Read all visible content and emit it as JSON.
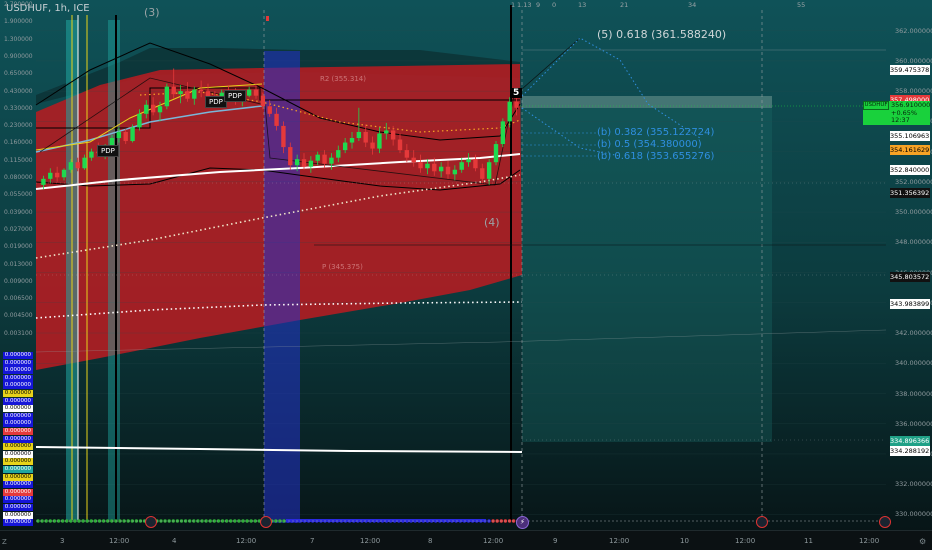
{
  "header": {
    "symbol_line": "USDHUF, 1h, ICE"
  },
  "colors": {
    "bull": "#26a69a",
    "bull_fill": "#1fd94f",
    "bear": "#e5393a",
    "cloud_red": "#b11d22",
    "teal": "#0e5155",
    "blue_zone": "#2232c8",
    "accent_green": "#19d13c",
    "white": "#ffffff",
    "fib_blue": "#2f8fe0"
  },
  "chart_data": {
    "type": "candlestick",
    "price_axis_right": {
      "ticks": [
        "362.000000",
        "360.000000",
        "358.000000",
        "356.000000",
        "354.000000",
        "352.000000",
        "350.000000",
        "348.000000",
        "346.000000",
        "344.000000",
        "342.000000",
        "340.000000",
        "338.000000",
        "336.000000",
        "334.000000",
        "332.000000",
        "330.000000"
      ],
      "range": [
        329.5,
        363.5
      ]
    },
    "price_tags": [
      {
        "label": "359.475378",
        "value": 359.475,
        "bg": "#ffffff",
        "fg": "#000000"
      },
      {
        "label": "357.498000",
        "value": 357.498,
        "bg": "#e5393a",
        "fg": "#ffffff"
      },
      {
        "label": "355.106963",
        "value": 355.107,
        "bg": "#ffffff",
        "fg": "#000000"
      },
      {
        "label": "354.161629",
        "value": 354.162,
        "bg": "#f7a325",
        "fg": "#000000"
      },
      {
        "label": "352.840000",
        "value": 352.84,
        "bg": "#ffffff",
        "fg": "#000000"
      },
      {
        "label": "351.356392",
        "value": 351.356,
        "bg": "#111111",
        "fg": "#ffffff"
      },
      {
        "label": "345.803572",
        "value": 345.804,
        "bg": "#111111",
        "fg": "#ffffff"
      },
      {
        "label": "343.983899",
        "value": 343.984,
        "bg": "#ffffff",
        "fg": "#000000"
      },
      {
        "label": "334.896366",
        "value": 334.896,
        "bg": "#20a187",
        "fg": "#ffffff"
      },
      {
        "label": "334.288192",
        "value": 334.288,
        "bg": "#ffffff",
        "fg": "#000000"
      }
    ],
    "last_price": {
      "symbol": "USDHUF",
      "value": "356.910000",
      "change": "+0.65%",
      "countdown": "12:37"
    },
    "left_axis_ticks": [
      "2.700000",
      "1.900000",
      "1.300000",
      "0.900000",
      "0.650000",
      "0.430000",
      "0.330000",
      "0.230000",
      "0.160000",
      "0.115000",
      "0.080000",
      "0.055000",
      "0.039000",
      "0.027000",
      "0.019000",
      "0.013000",
      "0.009000",
      "0.006500",
      "0.004500",
      "0.003100"
    ],
    "left_value_boxes": [
      {
        "label": "0.000000",
        "color": "#1515d8"
      },
      {
        "label": "0.000000",
        "color": "#1515d8"
      },
      {
        "label": "0.000000",
        "color": "#1515d8"
      },
      {
        "label": "0.000000",
        "color": "#1515d8"
      },
      {
        "label": "0.000000",
        "color": "#1515d8"
      },
      {
        "label": "0.000000",
        "color": "#e8d31a"
      },
      {
        "label": "0.000000",
        "color": "#1515d8"
      },
      {
        "label": "0.000000",
        "color": "#ffffff"
      },
      {
        "label": "0.000000",
        "color": "#1515d8"
      },
      {
        "label": "0.000000",
        "color": "#1515d8"
      },
      {
        "label": "0.000000",
        "color": "#e5393a"
      },
      {
        "label": "0.000000",
        "color": "#1515d8"
      },
      {
        "label": "0.000000",
        "color": "#e8d31a"
      },
      {
        "label": "0.000000",
        "color": "#ffffff"
      },
      {
        "label": "0.000000",
        "color": "#e8d31a"
      },
      {
        "label": "0.000000",
        "color": "#20a6a0"
      },
      {
        "label": "0.000000",
        "color": "#e8d31a"
      },
      {
        "label": "0.000000",
        "color": "#1515d8"
      },
      {
        "label": "0.000000",
        "color": "#e5393a"
      },
      {
        "label": "0.000000",
        "color": "#1515d8"
      },
      {
        "label": "0.000000",
        "color": "#1515d8"
      },
      {
        "label": "0.000000",
        "color": "#ffffff"
      },
      {
        "label": "0.000000",
        "color": "#1515d8"
      }
    ],
    "time_labels": [
      "3",
      "12:00",
      "4",
      "12:00",
      "7",
      "12:00",
      "8",
      "12:00",
      "9",
      "12:00",
      "10",
      "12:00",
      "11",
      "12:00"
    ],
    "annotations": {
      "wave_3": "(3)",
      "wave_4": "(4)",
      "wave_5": "5",
      "pdp": [
        "PDP",
        "PDP",
        "PDP"
      ],
      "fib_projection": [
        {
          "label": "(5) 0.618 (361.588240)",
          "value": 361.588
        },
        {
          "label": "(b) 0.382 (355.122724)",
          "value": 355.123
        },
        {
          "label": "(b) 0.5 (354.380000)",
          "value": 354.38
        },
        {
          "label": "(b) 0.618 (353.655276)",
          "value": 353.655
        }
      ],
      "pivot_labels": [
        "R2 (355.314)",
        "P (345.375)"
      ],
      "fib_top_numbers": [
        "1",
        "1.13",
        "9",
        "0",
        "13",
        "21",
        "34",
        "55"
      ]
    },
    "candles": [
      [
        351.8,
        352.4,
        351.5,
        352.2
      ],
      [
        352.2,
        352.9,
        351.9,
        352.6
      ],
      [
        352.6,
        353.0,
        352.0,
        352.3
      ],
      [
        352.3,
        352.9,
        352.1,
        352.8
      ],
      [
        352.8,
        353.5,
        352.6,
        353.3
      ],
      [
        353.3,
        353.6,
        352.7,
        352.9
      ],
      [
        352.9,
        353.8,
        352.8,
        353.6
      ],
      [
        353.6,
        354.2,
        353.4,
        354.0
      ],
      [
        354.0,
        354.6,
        353.7,
        353.9
      ],
      [
        353.9,
        354.5,
        353.5,
        354.3
      ],
      [
        354.3,
        355.1,
        354.1,
        354.9
      ],
      [
        354.9,
        355.6,
        354.6,
        355.3
      ],
      [
        355.3,
        355.5,
        354.5,
        354.7
      ],
      [
        354.7,
        355.8,
        354.6,
        355.6
      ],
      [
        355.6,
        356.8,
        355.4,
        356.5
      ],
      [
        356.5,
        357.4,
        356.2,
        357.1
      ],
      [
        357.1,
        357.6,
        356.4,
        356.6
      ],
      [
        356.6,
        357.3,
        356.0,
        357.0
      ],
      [
        357.0,
        358.5,
        356.8,
        358.3
      ],
      [
        358.3,
        359.5,
        357.5,
        357.8
      ],
      [
        357.8,
        358.4,
        357.2,
        358.0
      ],
      [
        358.0,
        358.6,
        357.3,
        357.5
      ],
      [
        357.5,
        358.3,
        357.1,
        358.1
      ],
      [
        358.1,
        358.7,
        357.6,
        358.0
      ],
      [
        358.0,
        358.5,
        357.4,
        357.6
      ],
      [
        357.6,
        358.0,
        357.0,
        357.4
      ],
      [
        357.4,
        358.1,
        357.2,
        357.9
      ],
      [
        357.9,
        358.4,
        357.5,
        357.8
      ],
      [
        357.8,
        358.2,
        357.1,
        357.3
      ],
      [
        357.3,
        357.9,
        357.0,
        357.7
      ],
      [
        357.7,
        358.3,
        357.6,
        358.1
      ],
      [
        358.1,
        358.5,
        357.5,
        357.7
      ],
      [
        357.7,
        357.9,
        356.8,
        357.0
      ],
      [
        357.0,
        357.4,
        356.3,
        356.5
      ],
      [
        356.5,
        356.9,
        355.4,
        355.7
      ],
      [
        355.7,
        356.0,
        353.9,
        354.3
      ],
      [
        354.3,
        354.6,
        352.8,
        353.1
      ],
      [
        353.1,
        353.8,
        352.7,
        353.5
      ],
      [
        353.5,
        353.9,
        352.8,
        353.0
      ],
      [
        353.0,
        353.7,
        352.6,
        353.4
      ],
      [
        353.4,
        354.0,
        353.1,
        353.8
      ],
      [
        353.8,
        354.1,
        352.9,
        353.2
      ],
      [
        353.2,
        353.9,
        352.8,
        353.6
      ],
      [
        353.6,
        354.4,
        353.3,
        354.1
      ],
      [
        354.1,
        354.9,
        353.9,
        354.6
      ],
      [
        354.6,
        355.3,
        354.2,
        354.9
      ],
      [
        354.9,
        356.9,
        354.7,
        355.3
      ],
      [
        355.3,
        355.8,
        354.3,
        354.6
      ],
      [
        354.6,
        355.0,
        353.8,
        354.2
      ],
      [
        354.2,
        355.6,
        353.9,
        355.2
      ],
      [
        355.2,
        355.9,
        354.8,
        355.4
      ],
      [
        355.4,
        355.7,
        354.4,
        354.8
      ],
      [
        354.8,
        355.2,
        353.9,
        354.1
      ],
      [
        354.1,
        354.5,
        353.3,
        353.6
      ],
      [
        353.6,
        354.1,
        353.0,
        353.3
      ],
      [
        353.3,
        353.8,
        352.6,
        352.9
      ],
      [
        352.9,
        353.5,
        352.5,
        353.2
      ],
      [
        353.2,
        353.6,
        352.4,
        352.7
      ],
      [
        352.7,
        353.3,
        352.3,
        353.0
      ],
      [
        353.0,
        353.4,
        352.2,
        352.5
      ],
      [
        352.5,
        353.1,
        352.1,
        352.8
      ],
      [
        352.8,
        353.6,
        352.6,
        353.3
      ],
      [
        353.3,
        353.9,
        353.0,
        353.5
      ],
      [
        353.5,
        353.8,
        352.7,
        352.9
      ],
      [
        352.9,
        353.2,
        351.9,
        352.2
      ],
      [
        352.2,
        353.5,
        351.8,
        353.3
      ],
      [
        353.3,
        354.7,
        353.1,
        354.5
      ],
      [
        354.5,
        356.2,
        354.3,
        356.0
      ],
      [
        356.0,
        357.6,
        355.6,
        357.3
      ],
      [
        357.3,
        357.8,
        356.4,
        356.9
      ]
    ]
  }
}
